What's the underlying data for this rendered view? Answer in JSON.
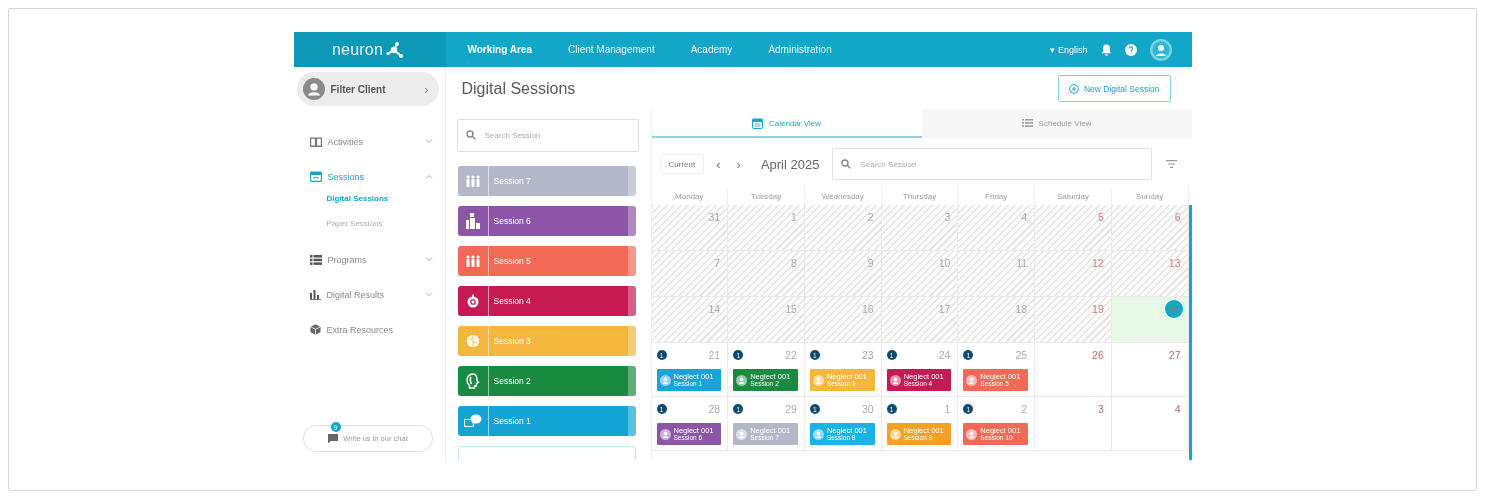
{
  "logo": {
    "text": "neuron"
  },
  "nav": [
    {
      "label": "Working Area",
      "selected": true
    },
    {
      "label": "Client Management",
      "selected": false
    },
    {
      "label": "Academy",
      "selected": false
    },
    {
      "label": "Administration",
      "selected": false
    }
  ],
  "language": {
    "caret": "▾",
    "label": "English"
  },
  "sidebar": {
    "filter": "Filter Client",
    "filter_arrow": "›",
    "items": [
      {
        "label": "Activities",
        "selected": false,
        "expanded": false
      },
      {
        "label": "Sessions",
        "selected": true,
        "expanded": true,
        "children": [
          {
            "label": "Digital Sessions",
            "selected": true
          },
          {
            "label": "Paper Sessions",
            "selected": false
          }
        ]
      },
      {
        "label": "Programs",
        "selected": false,
        "expanded": false
      },
      {
        "label": "Digital Results",
        "selected": false,
        "expanded": false
      },
      {
        "label": "Extra Resources",
        "selected": false
      }
    ]
  },
  "chat": {
    "label": "Write us in our chat",
    "badge": "9"
  },
  "page": {
    "title": "Digital Sessions",
    "new_button": "New Digital Session"
  },
  "session_search": {
    "placeholder": "Search Session"
  },
  "sessions": [
    {
      "label": "Session 7",
      "color": "#b4b7c7"
    },
    {
      "label": "Session 6",
      "color": "#8d55a8"
    },
    {
      "label": "Session 5",
      "color": "#f26a57"
    },
    {
      "label": "Session 4",
      "color": "#c51a52"
    },
    {
      "label": "Session 3",
      "color": "#f4b63c"
    },
    {
      "label": "Session 2",
      "color": "#1a8a40"
    },
    {
      "label": "Session 1",
      "color": "#14a4d4"
    }
  ],
  "calendar": {
    "tabs": [
      {
        "label": "Calendar View",
        "selected": true
      },
      {
        "label": "Schedule View",
        "selected": false
      }
    ],
    "current": "Current",
    "prev": "‹",
    "next": "›",
    "month": "April 2025",
    "search": {
      "placeholder": "Search Session"
    },
    "weekdays": [
      "Monday",
      "Tuesday",
      "Wednesday",
      "Thursday",
      "Friday",
      "Saturday",
      "Sunday"
    ],
    "weeks": [
      {
        "days": [
          {
            "day": "31",
            "past": true,
            "weekend": false,
            "today": false
          },
          {
            "day": "1",
            "past": true,
            "weekend": false,
            "today": false
          },
          {
            "day": "2",
            "past": true,
            "weekend": false,
            "today": false
          },
          {
            "day": "3",
            "past": true,
            "weekend": false,
            "today": false
          },
          {
            "day": "4",
            "past": true,
            "weekend": false,
            "today": false
          },
          {
            "day": "5",
            "past": true,
            "weekend": true,
            "today": false
          },
          {
            "day": "6",
            "past": true,
            "weekend": true,
            "today": false
          }
        ]
      },
      {
        "days": [
          {
            "day": "7",
            "past": true,
            "weekend": false,
            "today": false
          },
          {
            "day": "8",
            "past": true,
            "weekend": false,
            "today": false
          },
          {
            "day": "9",
            "past": true,
            "weekend": false,
            "today": false
          },
          {
            "day": "10",
            "past": true,
            "weekend": false,
            "today": false
          },
          {
            "day": "11",
            "past": true,
            "weekend": false,
            "today": false
          },
          {
            "day": "12",
            "past": true,
            "weekend": true,
            "today": false
          },
          {
            "day": "13",
            "past": true,
            "weekend": true,
            "today": false
          }
        ]
      },
      {
        "days": [
          {
            "day": "14",
            "past": true,
            "weekend": false,
            "today": false
          },
          {
            "day": "15",
            "past": true,
            "weekend": false,
            "today": false
          },
          {
            "day": "16",
            "past": true,
            "weekend": false,
            "today": false
          },
          {
            "day": "17",
            "past": true,
            "weekend": false,
            "today": false
          },
          {
            "day": "18",
            "past": true,
            "weekend": false,
            "today": false
          },
          {
            "day": "19",
            "past": true,
            "weekend": true,
            "today": false
          },
          {
            "day": "20",
            "past": false,
            "weekend": true,
            "today": true
          }
        ]
      },
      {
        "days": [
          {
            "day": "21",
            "past": false,
            "weekend": false,
            "today": false,
            "badge": "1",
            "events": [
              {
                "title": "Neglect 001",
                "subtitle": "Session 1",
                "color": "#1aa3d8"
              }
            ]
          },
          {
            "day": "22",
            "past": false,
            "weekend": false,
            "today": false,
            "badge": "1",
            "events": [
              {
                "title": "Neglect 001",
                "subtitle": "Session 2",
                "color": "#1a8a40"
              }
            ]
          },
          {
            "day": "23",
            "past": false,
            "weekend": false,
            "today": false,
            "badge": "1",
            "events": [
              {
                "title": "Neglect 001",
                "subtitle": "Session 3",
                "color": "#f4b63c"
              }
            ]
          },
          {
            "day": "24",
            "past": false,
            "weekend": false,
            "today": false,
            "badge": "1",
            "events": [
              {
                "title": "Neglect 001",
                "subtitle": "Session 4",
                "color": "#c51a52"
              }
            ]
          },
          {
            "day": "25",
            "past": false,
            "weekend": false,
            "today": false,
            "badge": "1",
            "events": [
              {
                "title": "Neglect 001",
                "subtitle": "Session 5",
                "color": "#f26a57"
              }
            ]
          },
          {
            "day": "26",
            "past": false,
            "weekend": true,
            "today": false
          },
          {
            "day": "27",
            "past": false,
            "weekend": true,
            "today": false
          }
        ]
      },
      {
        "days": [
          {
            "day": "28",
            "past": false,
            "weekend": false,
            "today": false,
            "badge": "1",
            "events": [
              {
                "title": "Neglect 001",
                "subtitle": "Session 6",
                "color": "#8d55a8"
              }
            ]
          },
          {
            "day": "29",
            "past": false,
            "weekend": false,
            "today": false,
            "badge": "1",
            "events": [
              {
                "title": "Neglect 001",
                "subtitle": "Session 7",
                "color": "#b4b7c7"
              }
            ]
          },
          {
            "day": "30",
            "past": false,
            "weekend": false,
            "today": false,
            "badge": "1",
            "events": [
              {
                "title": "Neglect 001",
                "subtitle": "Session 8",
                "color": "#19b3e6"
              }
            ]
          },
          {
            "day": "1",
            "past": false,
            "weekend": false,
            "today": false,
            "badge": "1",
            "events": [
              {
                "title": "Neglect 001",
                "subtitle": "Session 9",
                "color": "#f4a021"
              }
            ]
          },
          {
            "day": "2",
            "past": false,
            "weekend": false,
            "today": false,
            "badge": "1",
            "events": [
              {
                "title": "Neglect 001",
                "subtitle": "Session 10",
                "color": "#f26a57"
              }
            ]
          },
          {
            "day": "3",
            "past": false,
            "weekend": true,
            "today": false
          },
          {
            "day": "4",
            "past": false,
            "weekend": true,
            "today": false
          }
        ]
      }
    ]
  }
}
